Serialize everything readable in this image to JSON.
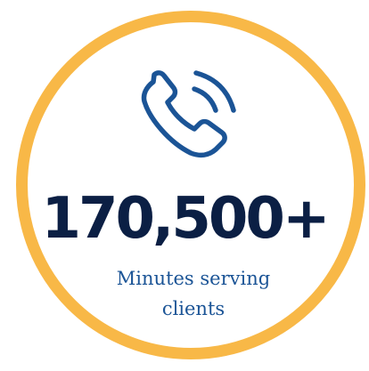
{
  "stat": {
    "value": "170,500+",
    "caption": "Minutes serving clients"
  },
  "icon": "phone-ringing-icon",
  "colors": {
    "ring": "#F8B847",
    "value_text": "#0B1F44",
    "caption_text": "#1B5496",
    "icon_stroke": "#1B5496"
  }
}
